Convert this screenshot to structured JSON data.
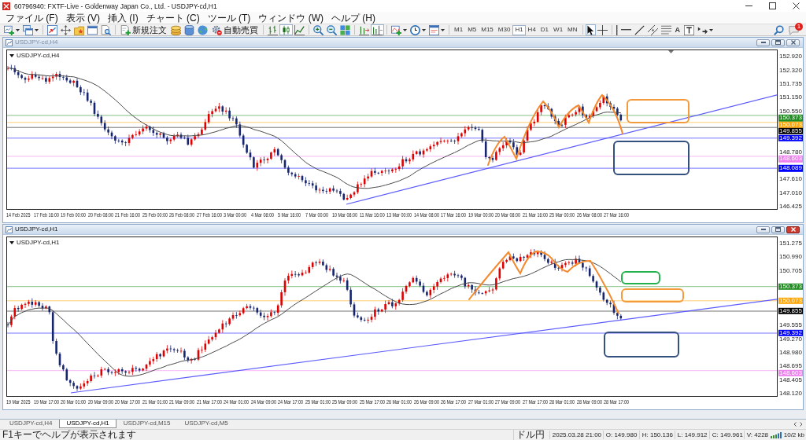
{
  "window": {
    "title": "60796940: FXTF-Live - Goldenway Japan Co., Ltd. - USDJPY-cd,H1"
  },
  "menu": [
    "ファイル (F)",
    "表示 (V)",
    "挿入 (I)",
    "チャート (C)",
    "ツール (T)",
    "ウィンドウ (W)",
    "ヘルプ (H)"
  ],
  "toolbar": {
    "new_order": "新規注文",
    "auto_trading": "自動売買",
    "chart_modes": [
      {
        "kind": "bars",
        "selected": false
      },
      {
        "kind": "candles",
        "selected": true
      },
      {
        "kind": "line",
        "selected": false
      }
    ],
    "toggles": [
      {
        "kind": "auto_scroll",
        "on": false
      },
      {
        "kind": "chart_shift",
        "on": true
      }
    ],
    "timeframes": [
      {
        "label": "M1",
        "selected": false
      },
      {
        "label": "M5",
        "selected": false
      },
      {
        "label": "M15",
        "selected": false
      },
      {
        "label": "M30",
        "selected": false
      },
      {
        "label": "H1",
        "selected": true
      },
      {
        "label": "H4",
        "selected": false
      },
      {
        "label": "D1",
        "selected": false
      },
      {
        "label": "W1",
        "selected": false
      },
      {
        "label": "MN",
        "selected": false
      }
    ],
    "pointer_tools": [
      {
        "kind": "cursor",
        "selected": true
      },
      {
        "kind": "crosshair",
        "selected": false
      }
    ],
    "text_tool": "A",
    "notification_count": "1"
  },
  "charts": [
    {
      "title": "USDJPY-cd,H4",
      "active": false,
      "symbol_label": "USDJPY-cd,H4",
      "shift_marker": true,
      "price_ticks": [
        "152.920",
        "152.320",
        "151.735",
        "151.150",
        "150.550",
        "148.780",
        "147.610",
        "147.010",
        "146.425"
      ],
      "levels": [
        {
          "price": "150.373",
          "color": "#1e8c1e"
        },
        {
          "price": "150.073",
          "color": "#ffa500"
        },
        {
          "price": "149.855",
          "color": "#000000"
        },
        {
          "price": "149.392",
          "color": "#0000ff"
        },
        {
          "price": "148.603",
          "color": "#ee82ee"
        },
        {
          "price": "148.089",
          "color": "#0000ff"
        }
      ],
      "time_ticks": [
        "14 Feb 2025",
        "17 Feb 16:00",
        "19 Feb 00:00",
        "20 Feb 08:00",
        "21 Feb 16:00",
        "25 Feb 00:00",
        "26 Feb 08:00",
        "27 Feb 16:00",
        "3 Mar 00:00",
        "4 Mar 08:00",
        "5 Mar 16:00",
        "7 Mar 00:00",
        "10 Mar 08:00",
        "11 Mar 16:00",
        "13 Mar 00:00",
        "14 Mar 08:00",
        "17 Mar 16:00",
        "19 Mar 00:00",
        "20 Mar 08:00",
        "21 Mar 16:00",
        "25 Mar 00:00",
        "26 Mar 08:00",
        "27 Mar 16:00"
      ]
    },
    {
      "title": "USDJPY-cd,H1",
      "active": true,
      "symbol_label": "USDJPY-cd,H1",
      "shift_marker": false,
      "price_ticks": [
        "151.275",
        "150.990",
        "150.705",
        "149.555",
        "149.270",
        "148.980",
        "148.695",
        "148.405",
        "148.120"
      ],
      "levels": [
        {
          "price": "150.373",
          "color": "#1e8c1e"
        },
        {
          "price": "150.073",
          "color": "#ffa500"
        },
        {
          "price": "149.855",
          "color": "#000000"
        },
        {
          "price": "149.392",
          "color": "#0000ff"
        },
        {
          "price": "148.603",
          "color": "#ee82ee"
        }
      ],
      "time_ticks": [
        "19 Mar 2025",
        "19 Mar 17:00",
        "20 Mar 01:00",
        "20 Mar 09:00",
        "20 Mar 17:00",
        "21 Mar 01:00",
        "21 Mar 09:00",
        "21 Mar 17:00",
        "24 Mar 01:00",
        "24 Mar 09:00",
        "24 Mar 17:00",
        "25 Mar 01:00",
        "25 Mar 09:00",
        "25 Mar 17:00",
        "26 Mar 01:00",
        "26 Mar 09:00",
        "26 Mar 17:00",
        "27 Mar 01:00",
        "27 Mar 09:00",
        "27 Mar 17:00",
        "28 Mar 01:00",
        "28 Mar 09:00",
        "28 Mar 17:00"
      ]
    }
  ],
  "tabs": [
    {
      "label": "USDJPY-cd,H4",
      "selected": false
    },
    {
      "label": "USDJPY-cd,H1",
      "selected": true
    },
    {
      "label": "USDJPY-cd,M15",
      "selected": false
    },
    {
      "label": "USDJPY-cd,M5",
      "selected": false
    }
  ],
  "status_bar": {
    "help": "F1キーでヘルプが表示されます",
    "symbol": "ドル円",
    "time": "2025.03.28 21:00",
    "open": "O: 149.980",
    "high": "H: 150.136",
    "low": "L: 149.912",
    "close": "C: 149.961",
    "volume": "V: 4228",
    "traffic": "10/2 kb"
  }
}
